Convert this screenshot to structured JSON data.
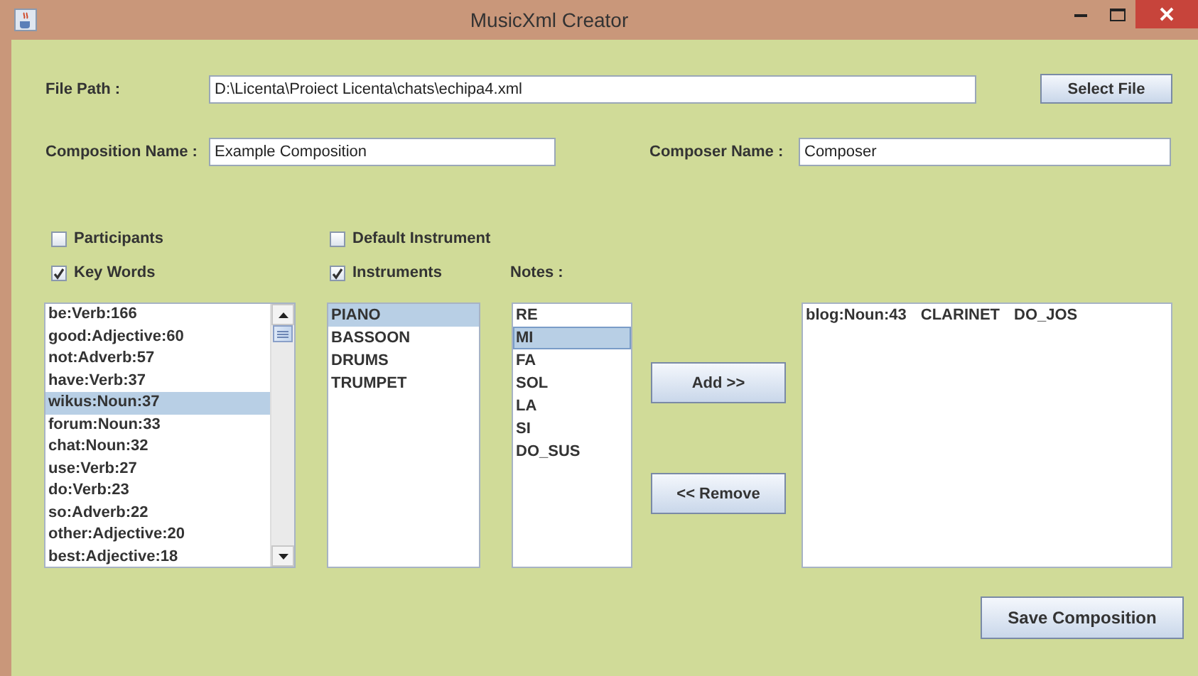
{
  "window": {
    "title": "MusicXml Creator"
  },
  "file_path": {
    "label": "File Path :",
    "value": "D:\\Licenta\\Proiect Licenta\\chats\\echipa4.xml"
  },
  "select_file_button": "Select File",
  "composition_name": {
    "label": "Composition Name :",
    "value": "Example Composition"
  },
  "composer_name": {
    "label": "Composer Name :",
    "value": "Composer"
  },
  "checkboxes": [
    {
      "label": "Participants",
      "checked": false
    },
    {
      "label": "Default Instrument",
      "checked": false
    },
    {
      "label": "Key Words",
      "checked": true
    },
    {
      "label": "Instruments",
      "checked": true
    }
  ],
  "notes_label": "Notes :",
  "keywords": [
    {
      "label": "be:Verb:166",
      "selected": false
    },
    {
      "label": "good:Adjective:60",
      "selected": false
    },
    {
      "label": "not:Adverb:57",
      "selected": false
    },
    {
      "label": "have:Verb:37",
      "selected": false
    },
    {
      "label": "wikus:Noun:37",
      "selected": true
    },
    {
      "label": "forum:Noun:33",
      "selected": false
    },
    {
      "label": "chat:Noun:32",
      "selected": false
    },
    {
      "label": "use:Verb:27",
      "selected": false
    },
    {
      "label": "do:Verb:23",
      "selected": false
    },
    {
      "label": "so:Adverb:22",
      "selected": false
    },
    {
      "label": "other:Adjective:20",
      "selected": false
    },
    {
      "label": "best:Adjective:18",
      "selected": false
    }
  ],
  "instruments": [
    {
      "label": "PIANO",
      "selected": true
    },
    {
      "label": "BASSOON",
      "selected": false
    },
    {
      "label": "DRUMS",
      "selected": false
    },
    {
      "label": "TRUMPET",
      "selected": false
    }
  ],
  "notes": [
    {
      "label": "RE",
      "selected": false
    },
    {
      "label": "MI",
      "selected": true
    },
    {
      "label": "FA",
      "selected": false
    },
    {
      "label": "SOL",
      "selected": false
    },
    {
      "label": "LA",
      "selected": false
    },
    {
      "label": "SI",
      "selected": false
    },
    {
      "label": "DO_SUS",
      "selected": false
    }
  ],
  "add_button": "Add >>",
  "remove_button": "<< Remove",
  "composition_rows": [
    {
      "cells": [
        "blog:Noun:43",
        "CLARINET",
        "DO_JOS"
      ]
    }
  ],
  "save_button": "Save Composition"
}
